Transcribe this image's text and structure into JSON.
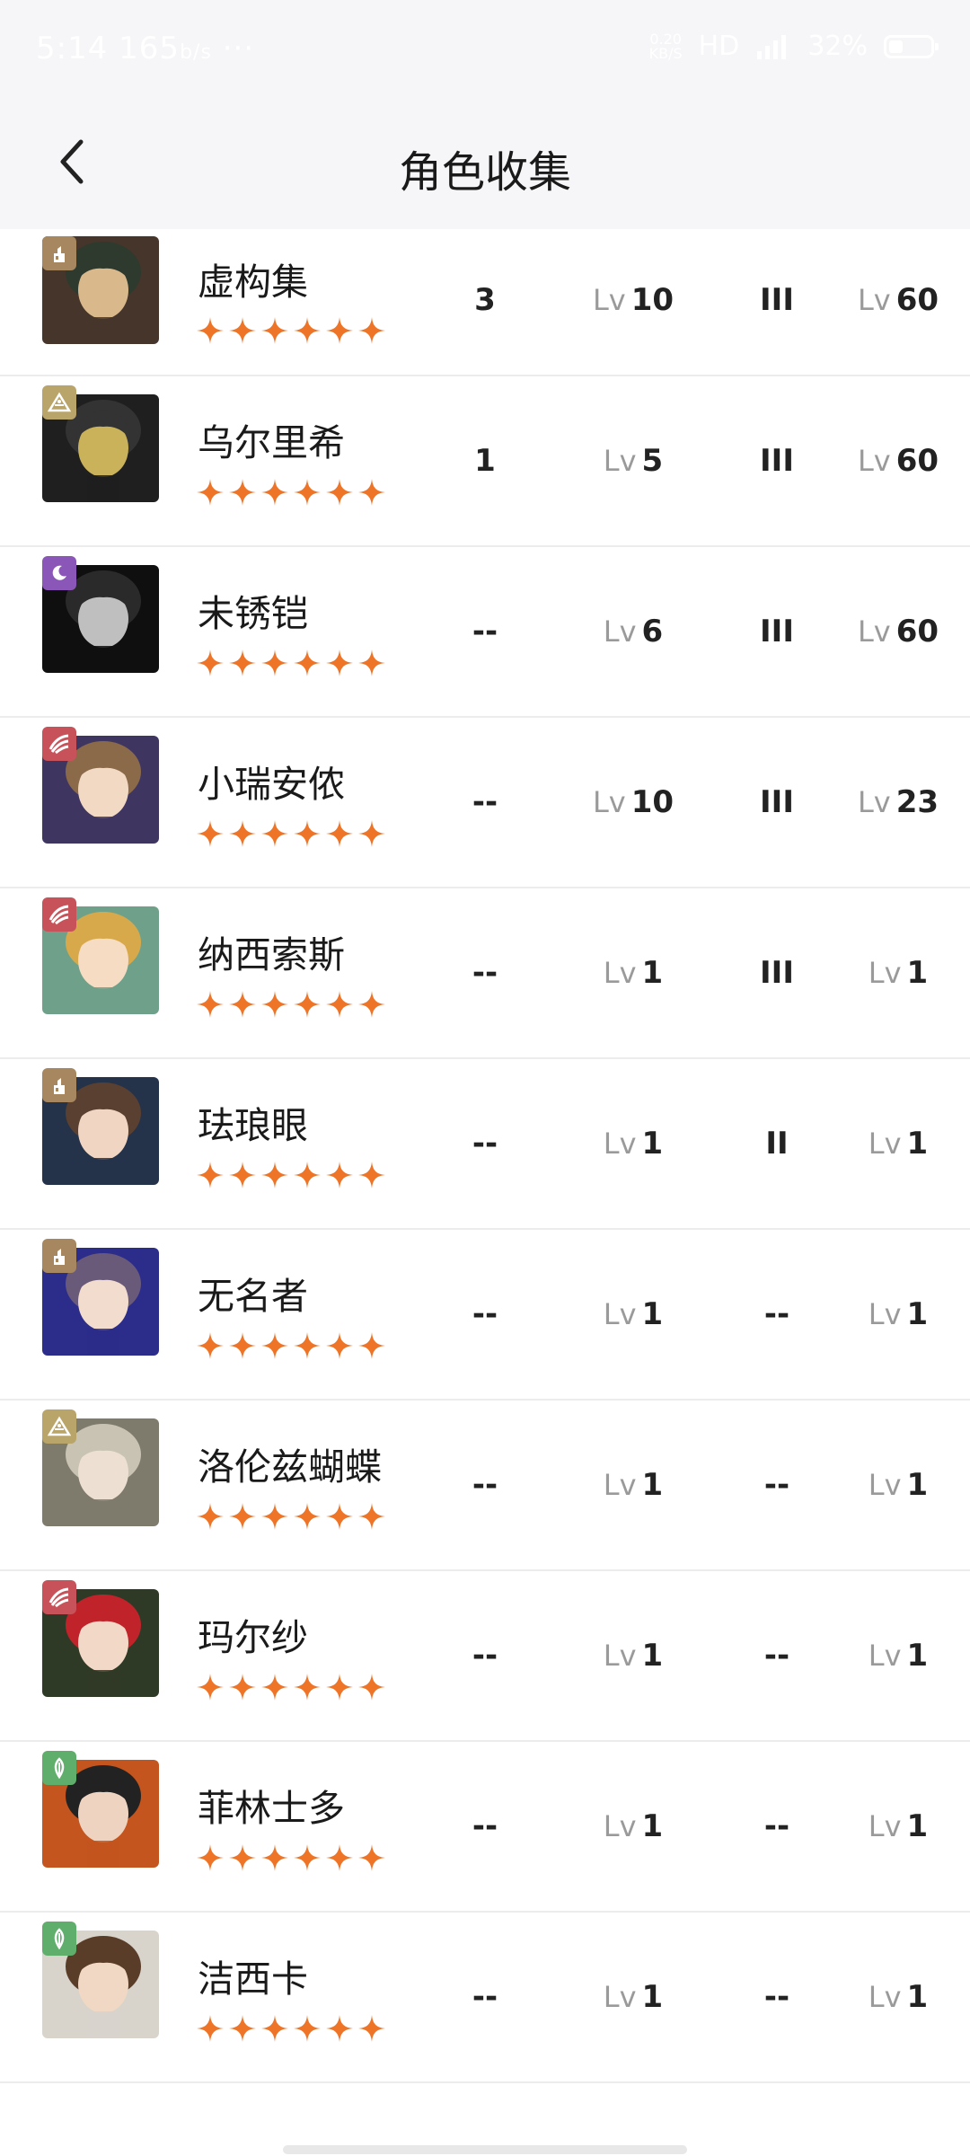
{
  "status_bar": {
    "time": "5:14",
    "speed_left": "165",
    "speed_left_unit": "b/s",
    "dots": "···",
    "net_speed": "0.20",
    "net_unit": "KB/S",
    "hd": "HD",
    "battery": "32%"
  },
  "header": {
    "title": "角色收集"
  },
  "colors": {
    "star": "#ee7428",
    "attr_brown": "#a7875f",
    "attr_khaki": "#b9a46a",
    "attr_purple": "#8a56b8",
    "attr_red": "#c8525a",
    "attr_green": "#5fae6b"
  },
  "lv_label": "Lv",
  "characters": [
    {
      "name": "虚构集",
      "attr_icon": "intellect-icon",
      "attr_color": "#a7875f",
      "stars": 6,
      "c1": "3",
      "c2": "10",
      "c3": "III",
      "c4": "60",
      "portrait": [
        "#d9b88c",
        "#2e3a2e",
        "#46352a"
      ]
    },
    {
      "name": "乌尔里希",
      "attr_icon": "plant-icon",
      "attr_color": "#b9a46a",
      "stars": 6,
      "c1": "1",
      "c2": "5",
      "c3": "III",
      "c4": "60",
      "portrait": [
        "#c9b25a",
        "#333333",
        "#1f1f1f"
      ]
    },
    {
      "name": "未锈铠",
      "attr_icon": "spirit-icon",
      "attr_color": "#8a56b8",
      "stars": 6,
      "c1": "--",
      "c2": "6",
      "c3": "III",
      "c4": "60",
      "portrait": [
        "#bfbfbf",
        "#2a2a2a",
        "#0f0f0f"
      ]
    },
    {
      "name": "小瑞安侬",
      "attr_icon": "beast-icon",
      "attr_color": "#c8525a",
      "stars": 6,
      "c1": "--",
      "c2": "10",
      "c3": "III",
      "c4": "23",
      "portrait": [
        "#f1d9c4",
        "#8b6a4a",
        "#3e3560"
      ]
    },
    {
      "name": "纳西索斯",
      "attr_icon": "beast-icon",
      "attr_color": "#c8525a",
      "stars": 6,
      "c1": "--",
      "c2": "1",
      "c3": "III",
      "c4": "1",
      "portrait": [
        "#f5dcc2",
        "#d8a94a",
        "#6fa08a"
      ]
    },
    {
      "name": "珐琅眼",
      "attr_icon": "intellect-icon",
      "attr_color": "#a7875f",
      "stars": 6,
      "c1": "--",
      "c2": "1",
      "c3": "II",
      "c4": "1",
      "portrait": [
        "#f0d6c2",
        "#5a4030",
        "#24324a"
      ]
    },
    {
      "name": "无名者",
      "attr_icon": "intellect-icon",
      "attr_color": "#a7875f",
      "stars": 6,
      "c1": "--",
      "c2": "1",
      "c3": "--",
      "c4": "1",
      "portrait": [
        "#f1dccd",
        "#6a5a7a",
        "#2c2c8a"
      ]
    },
    {
      "name": "洛伦兹蝴蝶",
      "attr_icon": "plant-icon",
      "attr_color": "#b9a46a",
      "stars": 6,
      "c1": "--",
      "c2": "1",
      "c3": "--",
      "c4": "1",
      "portrait": [
        "#ede0d2",
        "#c9c3b4",
        "#7e7a6c"
      ]
    },
    {
      "name": "玛尔纱",
      "attr_icon": "beast-icon",
      "attr_color": "#c8525a",
      "stars": 6,
      "c1": "--",
      "c2": "1",
      "c3": "--",
      "c4": "1",
      "portrait": [
        "#f2d8c6",
        "#c0242a",
        "#2f3a26"
      ]
    },
    {
      "name": "菲林士多",
      "attr_icon": "star-icon",
      "attr_color": "#5fae6b",
      "stars": 6,
      "c1": "--",
      "c2": "1",
      "c3": "--",
      "c4": "1",
      "portrait": [
        "#eed4c0",
        "#222222",
        "#c4551e"
      ]
    },
    {
      "name": "洁西卡",
      "attr_icon": "star-icon",
      "attr_color": "#5fae6b",
      "stars": 6,
      "c1": "--",
      "c2": "1",
      "c3": "--",
      "c4": "1",
      "portrait": [
        "#f0d8c4",
        "#5a3d28",
        "#d8d4cc"
      ]
    }
  ]
}
